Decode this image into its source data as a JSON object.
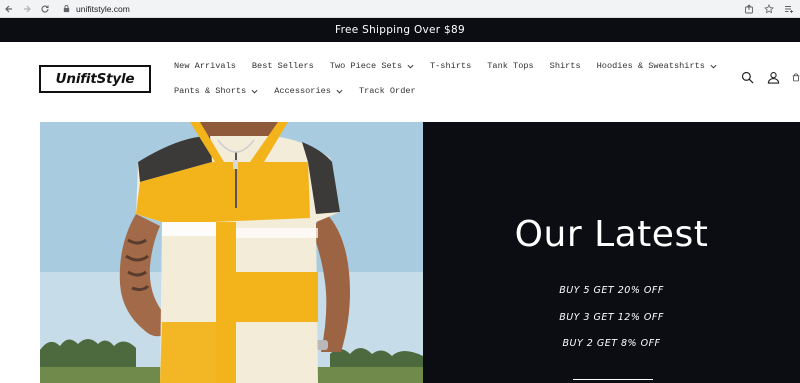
{
  "browser": {
    "url": "unifitstyle.com"
  },
  "announcement": {
    "text": "Free Shipping Over $89"
  },
  "header": {
    "logo_text": "UnifitStyle",
    "menu_row1": [
      {
        "label": "New Arrivals",
        "has_dropdown": false
      },
      {
        "label": "Best Sellers",
        "has_dropdown": false
      },
      {
        "label": "Two Piece Sets",
        "has_dropdown": true
      },
      {
        "label": "T-shirts",
        "has_dropdown": false
      },
      {
        "label": "Tank Tops",
        "has_dropdown": false
      },
      {
        "label": "Shirts",
        "has_dropdown": false
      },
      {
        "label": "Hoodies & Sweatshirts",
        "has_dropdown": true
      }
    ],
    "menu_row2": [
      {
        "label": "Pants & Shorts",
        "has_dropdown": true
      },
      {
        "label": "Accessories",
        "has_dropdown": true
      },
      {
        "label": "Track Order",
        "has_dropdown": false
      }
    ],
    "icons": [
      "search-icon",
      "account-icon",
      "cart-icon"
    ]
  },
  "hero": {
    "title": "Our Latest",
    "offers": [
      "BUY 5 GET 20% OFF",
      "BUY 3 GET 12% OFF",
      "BUY 2 GET 8% OFF"
    ]
  },
  "colors": {
    "dark": "#0b0d13",
    "accent_yellow": "#f2b31b",
    "cream": "#f3ecd9",
    "charcoal": "#3b3a38"
  }
}
